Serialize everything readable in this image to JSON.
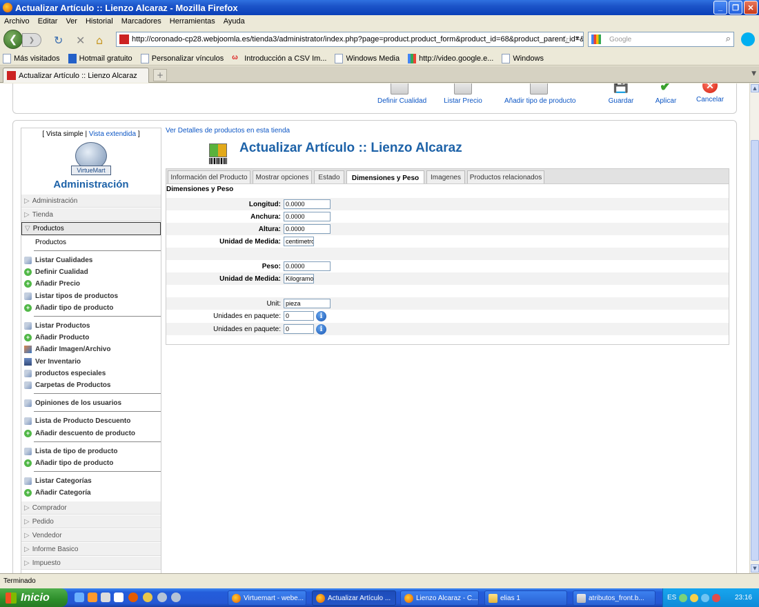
{
  "window": {
    "title": "Actualizar Artículo :: Lienzo Alcaraz - Mozilla Firefox"
  },
  "menu": [
    "Archivo",
    "Editar",
    "Ver",
    "Historial",
    "Marcadores",
    "Herramientas",
    "Ayuda"
  ],
  "nav": {
    "url": "http://coronado-cp28.webjoomla.es/tienda3/administrator/index.php?page=product.product_form&product_id=68&product_parent_id=&option=com",
    "search_placeholder": "Google"
  },
  "bookmarks": [
    "Más visitados",
    "Hotmail gratuito",
    "Personalizar vínculos",
    "Introducción a CSV Im...",
    "Windows Media",
    "http://video.google.e...",
    "Windows"
  ],
  "browser_tab": {
    "label": "Actualizar Artículo :: Lienzo Alcaraz",
    "new_tab": "+"
  },
  "toolbar": {
    "definir_cualidad": "Definir Cualidad",
    "listar_precio": "Listar Precio",
    "anadir_tipo": "Añadir tipo de producto",
    "guardar": "Guardar",
    "aplicar": "Aplicar",
    "cancelar": "Cancelar"
  },
  "sidebar": {
    "view_left": "[ Vista simple |",
    "view_link": "Vista extendida",
    "view_right": "]",
    "logo_text": "VirtueMart",
    "title": "Administración",
    "sections_top": [
      "Administración",
      "Tienda"
    ],
    "open_section": "Productos",
    "sub_item": "Productos",
    "group1": [
      "Listar Cualidades",
      "Definir Cualidad",
      "Añadir Precio",
      "Listar tipos de productos",
      "Añadir tipo de producto"
    ],
    "group2": [
      "Listar Productos",
      "Añadir Producto",
      "Añadir Imagen/Archivo",
      "Ver Inventario",
      "productos especiales",
      "Carpetas de Productos"
    ],
    "group3": [
      "Opiniones de los usuarios"
    ],
    "group4": [
      "Lista de Producto Descuento",
      "Añadir descuento de producto"
    ],
    "group5": [
      "Lista de tipo de producto",
      "Añadir tipo de producto"
    ],
    "group6": [
      "Listar Categorías",
      "Añadir Categoría"
    ],
    "sections_bottom": [
      "Comprador",
      "Pedido",
      "Vendedor",
      "Informe Basico",
      "Impuesto"
    ]
  },
  "content": {
    "breadcrumb": "Ver Detalles de productos en esta tienda",
    "title": "Actualizar Artículo :: Lienzo Alcaraz",
    "tabs": [
      "Información del Producto",
      "Mostrar opciones",
      "Estado",
      "Dimensiones y Peso",
      "Imagenes",
      "Productos relacionados"
    ],
    "active_tab": "Dimensiones y Peso",
    "section_heading": "Dimensiones y Peso",
    "fields": {
      "longitud_label": "Longitud:",
      "longitud_value": "0.0000",
      "anchura_label": "Anchura:",
      "anchura_value": "0.0000",
      "altura_label": "Altura:",
      "altura_value": "0.0000",
      "unidad_medida_label": "Unidad de Medida:",
      "unidad_medida_value": "centimetro",
      "peso_label": "Peso:",
      "peso_value": "0.0000",
      "unidad_peso_label": "Unidad de Medida:",
      "unidad_peso_value": "Kilogramo",
      "unit_label": "Unit:",
      "unit_value": "pieza",
      "paquete1_label": "Unidades en paquete:",
      "paquete1_value": "0",
      "paquete2_label": "Unidades en paquete:",
      "paquete2_value": "0"
    }
  },
  "status": "Terminado",
  "taskbar": {
    "start": "Inicio",
    "tasks": [
      "Virtuemart - webe...",
      "Actualizar Artículo ...",
      "Lienzo Alcaraz - C...",
      "elias 1",
      "atributos_front.b..."
    ],
    "lang": "ES",
    "time": "23:16"
  }
}
